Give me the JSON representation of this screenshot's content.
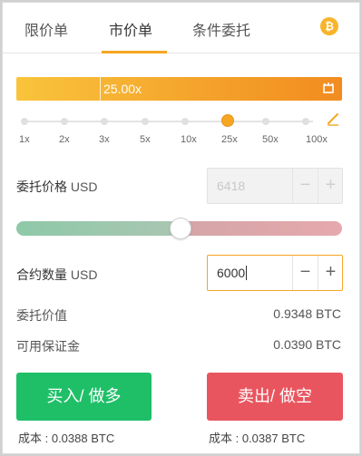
{
  "tabs": [
    {
      "label": "限价单"
    },
    {
      "label": "市价单"
    },
    {
      "label": "条件委托"
    }
  ],
  "coin_icon": {
    "glyph": "₿",
    "icon": "bitcoin-icon",
    "color": "#f7b52c"
  },
  "leverage": {
    "value_text": "25.00x",
    "ticks": [
      "1x",
      "2x",
      "3x",
      "5x",
      "10x",
      "25x",
      "50x",
      "100x"
    ],
    "selected": "25x",
    "accent": "#f5a623"
  },
  "order_price": {
    "label": "委托价格",
    "unit": "USD",
    "value": "6418",
    "minus": "−",
    "plus": "+"
  },
  "quantity": {
    "label": "合约数量",
    "unit": "USD",
    "value": "6000",
    "minus": "−",
    "plus": "+"
  },
  "order_value": {
    "label": "委托价值",
    "value": "0.9348 BTC"
  },
  "available_margin": {
    "label": "可用保证金",
    "value": "0.0390 BTC"
  },
  "buy_button": {
    "label": "买入/ 做多",
    "color": "#1fbf68",
    "cost": "成本 : 0.0388 BTC"
  },
  "sell_button": {
    "label": "卖出/ 做空",
    "color": "#e9555f",
    "cost": "成本 : 0.0387 BTC"
  }
}
